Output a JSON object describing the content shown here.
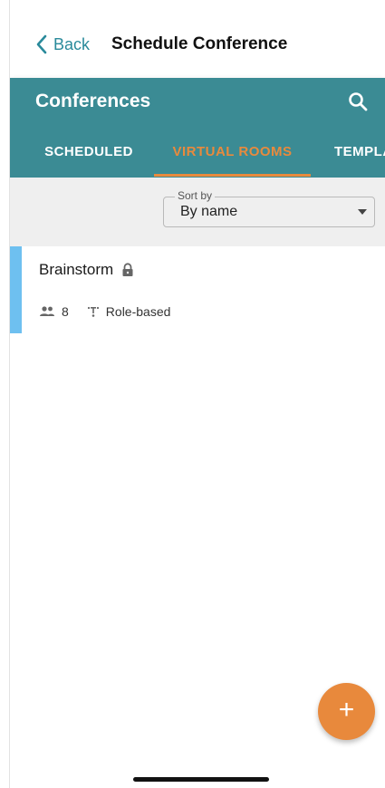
{
  "navbar": {
    "back_label": "Back",
    "title": "Schedule Conference"
  },
  "appbar": {
    "title": "Conferences",
    "search_icon": "search-icon"
  },
  "tabs": [
    {
      "label": "SCHEDULED",
      "active": false
    },
    {
      "label": "VIRTUAL ROOMS",
      "active": true
    },
    {
      "label": "TEMPLATES",
      "active": false
    }
  ],
  "sort": {
    "legend": "Sort by",
    "value": "By name"
  },
  "rooms": [
    {
      "name": "Brainstorm",
      "locked": true,
      "participants": "8",
      "mode": "Role-based"
    }
  ],
  "fab": {
    "label": "+"
  },
  "colors": {
    "appbar": "#3b8b94",
    "accent": "#e88a3d",
    "link": "#2a8a9b",
    "room_accent": "#6ec0f0",
    "sortbar": "#efefef"
  }
}
